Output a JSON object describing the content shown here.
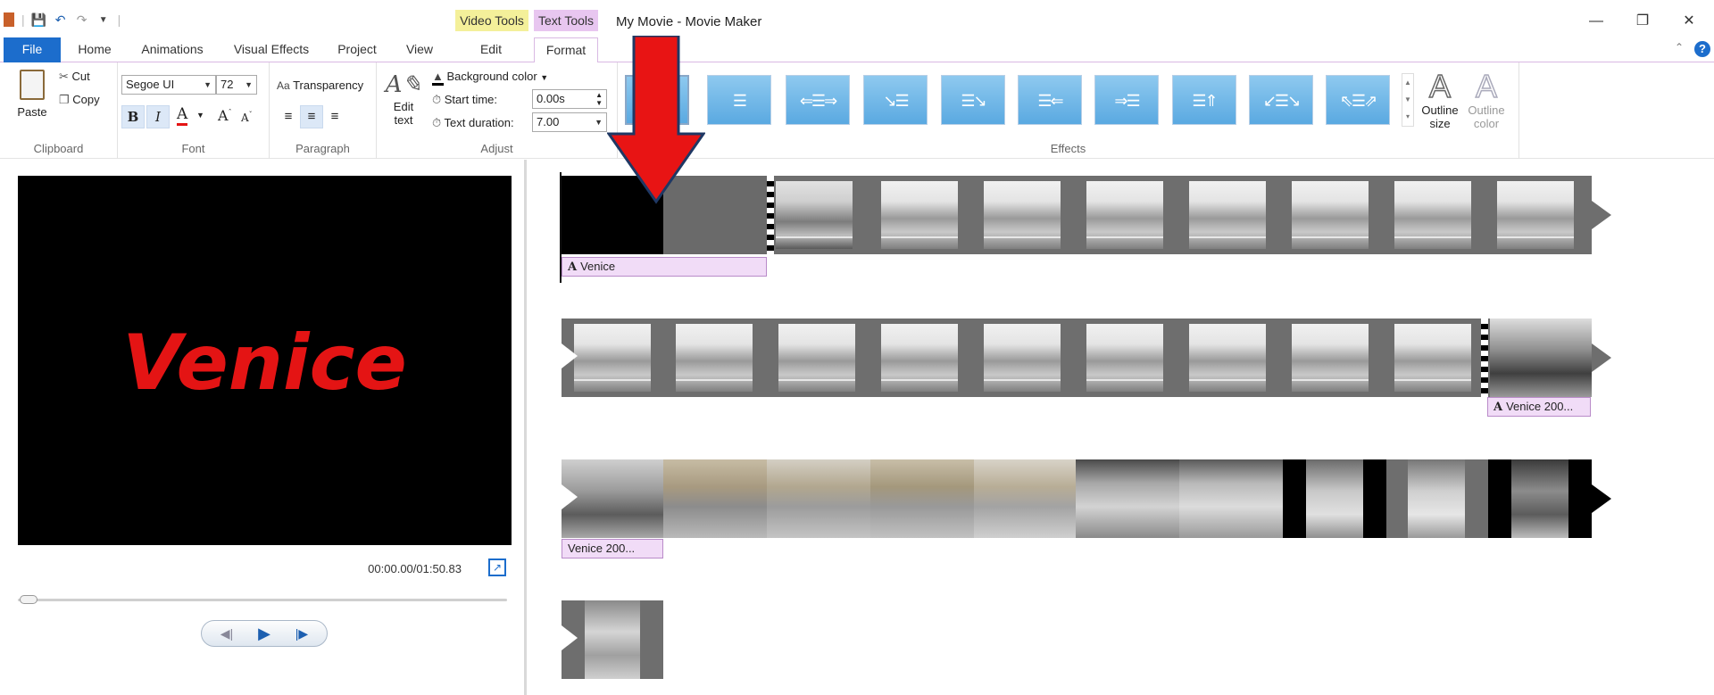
{
  "titlebar": {
    "context_video": "Video Tools",
    "context_text": "Text Tools",
    "title": "My Movie - Movie Maker"
  },
  "tabs": {
    "file": "File",
    "home": "Home",
    "animations": "Animations",
    "visual_effects": "Visual Effects",
    "project": "Project",
    "view": "View",
    "edit": "Edit",
    "format": "Format"
  },
  "ribbon": {
    "clipboard": {
      "paste": "Paste",
      "cut": "Cut",
      "copy": "Copy",
      "label": "Clipboard"
    },
    "font": {
      "family": "Segoe UI",
      "size": "72",
      "bold": "B",
      "italic": "I",
      "color": "A",
      "grow": "A",
      "shrink": "A",
      "label": "Font"
    },
    "paragraph": {
      "transparency": "Transparency",
      "label": "Paragraph"
    },
    "adjust": {
      "edit_text": "Edit text",
      "background_color": "Background color",
      "start_time_label": "Start time:",
      "start_time_value": "0.00s",
      "text_duration_label": "Text duration:",
      "text_duration_value": "7.00",
      "label": "Adjust"
    },
    "effects": {
      "label": "Effects",
      "outline_size": "Outline size",
      "outline_color": "Outline color"
    }
  },
  "preview": {
    "overlay_text": "Venice",
    "timecode": "00:00.00/01:50.83"
  },
  "storyboard": {
    "caption1": "Venice",
    "caption2": "Venice 200...",
    "caption3": "Venice 200..."
  },
  "colors": {
    "accent": "#1c6dcc",
    "text_tools_tab": "#e8c6f0",
    "video_tools_tab": "#f4f09a",
    "overlay_text": "#e41414",
    "arrow": "#e81414"
  }
}
